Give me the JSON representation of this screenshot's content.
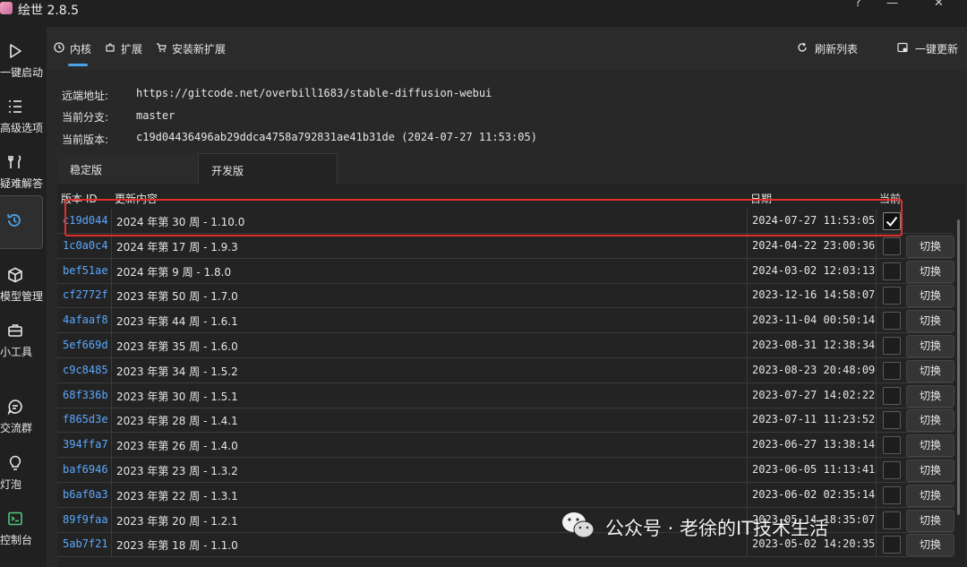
{
  "window": {
    "title": "绘世 2.8.5",
    "help_glyph": "?",
    "minimize_glyph": "—",
    "close_glyph": "✕"
  },
  "sidebar": {
    "items": [
      {
        "label": "一键启动",
        "icon": "play-icon"
      },
      {
        "label": "高级选项",
        "icon": "list-icon"
      },
      {
        "label": "疑难解答",
        "icon": "tools-icon"
      },
      {
        "label": "",
        "icon": "history-icon",
        "active": true
      },
      {
        "label": "模型管理",
        "icon": "cube-icon"
      },
      {
        "label": "小工具",
        "icon": "toolbox-icon"
      },
      {
        "label": "交流群",
        "icon": "chat-icon"
      },
      {
        "label": "灯泡",
        "icon": "bulb-icon"
      },
      {
        "label": "控制台",
        "icon": "console-icon"
      }
    ]
  },
  "tabs": {
    "core": "内核",
    "extensions": "扩展",
    "install_ext": "安装新扩展",
    "refresh": "刷新列表",
    "update_all": "一键更新"
  },
  "repo": {
    "remote_label": "远端地址:",
    "remote_value": "https://gitcode.net/overbill1683/stable-diffusion-webui",
    "branch_label": "当前分支:",
    "branch_value": "master",
    "version_label": "当前版本:",
    "version_value": "c19d04436496ab29ddca4758a792831ae41b31de (2024-07-27 11:53:05)"
  },
  "version_tabs": {
    "stable": "稳定版",
    "dev": "开发版"
  },
  "table": {
    "headers": {
      "id": "版本 ID",
      "desc": "更新内容",
      "date": "日期",
      "current": "当前"
    },
    "switch_label": "切换",
    "rows": [
      {
        "id": "c19d044",
        "desc": "2024 年第 30 周 - 1.10.0",
        "date": "2024-07-27 11:53:05",
        "current": true
      },
      {
        "id": "1c0a0c4",
        "desc": "2024 年第 17 周 - 1.9.3",
        "date": "2024-04-22 23:00:36",
        "current": false
      },
      {
        "id": "bef51ae",
        "desc": "2024 年第 9 周 - 1.8.0",
        "date": "2024-03-02 12:03:13",
        "current": false
      },
      {
        "id": "cf2772f",
        "desc": "2023 年第 50 周 - 1.7.0",
        "date": "2023-12-16 14:58:07",
        "current": false
      },
      {
        "id": "4afaaf8",
        "desc": "2023 年第 44 周 - 1.6.1",
        "date": "2023-11-04 00:50:14",
        "current": false
      },
      {
        "id": "5ef669d",
        "desc": "2023 年第 35 周 - 1.6.0",
        "date": "2023-08-31 12:38:34",
        "current": false
      },
      {
        "id": "c9c8485",
        "desc": "2023 年第 34 周 - 1.5.2",
        "date": "2023-08-23 20:48:09",
        "current": false
      },
      {
        "id": "68f336b",
        "desc": "2023 年第 30 周 - 1.5.1",
        "date": "2023-07-27 14:02:22",
        "current": false
      },
      {
        "id": "f865d3e",
        "desc": "2023 年第 28 周 - 1.4.1",
        "date": "2023-07-11 11:23:52",
        "current": false
      },
      {
        "id": "394ffa7",
        "desc": "2023 年第 26 周 - 1.4.0",
        "date": "2023-06-27 13:38:14",
        "current": false
      },
      {
        "id": "baf6946",
        "desc": "2023 年第 23 周 - 1.3.2",
        "date": "2023-06-05 11:13:41",
        "current": false
      },
      {
        "id": "b6af0a3",
        "desc": "2023 年第 22 周 - 1.3.1",
        "date": "2023-06-02 02:35:14",
        "current": false
      },
      {
        "id": "89f9faa",
        "desc": "2023 年第 20 周 - 1.2.1",
        "date": "2023-05-14 18:35:07",
        "current": false
      },
      {
        "id": "5ab7f21",
        "desc": "2023 年第 18 周 - 1.1.0",
        "date": "2023-05-02 14:20:35",
        "current": false
      }
    ]
  },
  "watermark": "公众号 · 老徐的IT技术生活",
  "colors": {
    "accent": "#4aa3e8",
    "id_link": "#5aa8ff",
    "highlight": "#e0302b"
  }
}
